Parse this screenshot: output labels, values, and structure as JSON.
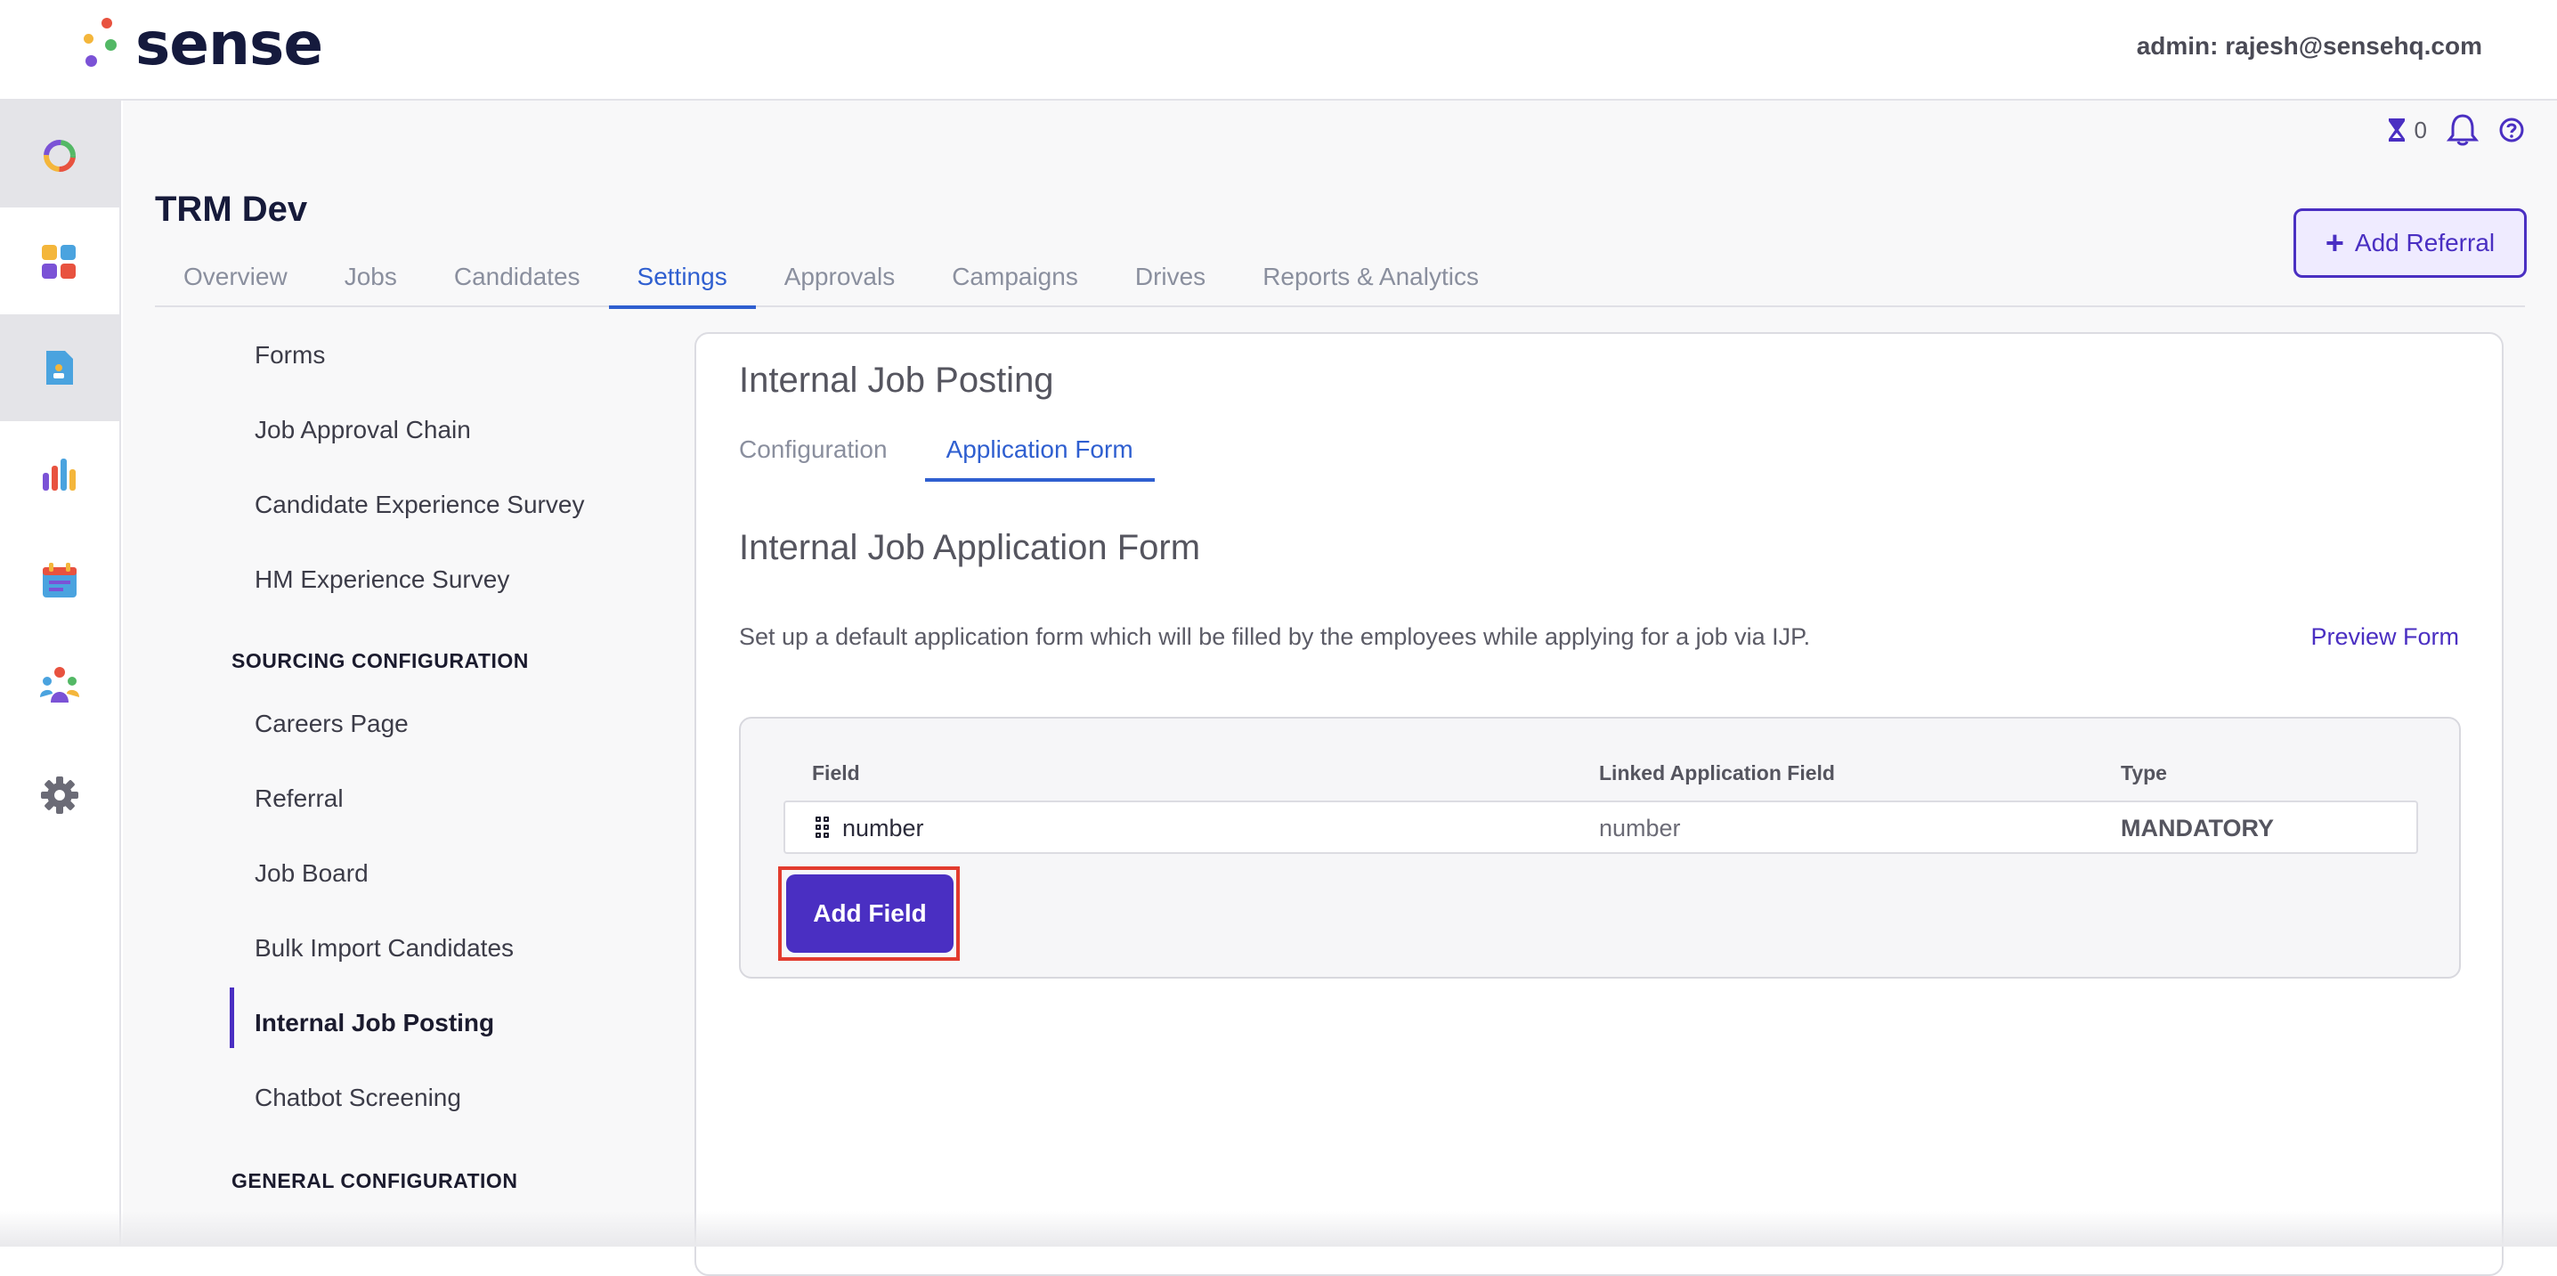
{
  "app": {
    "logo_text": "sense",
    "admin_label": "admin: rajesh@sensehq.com"
  },
  "rail": {
    "items": [
      {
        "name": "dashboard-ring-icon"
      },
      {
        "name": "apps-grid-icon"
      },
      {
        "name": "document-person-icon",
        "active": true
      },
      {
        "name": "bar-chart-icon"
      },
      {
        "name": "calendar-icon"
      },
      {
        "name": "people-group-icon"
      },
      {
        "name": "gear-icon"
      }
    ]
  },
  "utility": {
    "timer_count": "0"
  },
  "project": {
    "title": "TRM Dev"
  },
  "tabs": [
    {
      "label": "Overview"
    },
    {
      "label": "Jobs"
    },
    {
      "label": "Candidates"
    },
    {
      "label": "Settings",
      "active": true
    },
    {
      "label": "Approvals"
    },
    {
      "label": "Campaigns"
    },
    {
      "label": "Drives"
    },
    {
      "label": "Reports & Analytics"
    }
  ],
  "add_referral_label": "Add Referral",
  "subnav": {
    "items_top": [
      "Forms",
      "Job Approval Chain",
      "Candidate Experience Survey",
      "HM Experience Survey"
    ],
    "sourcing_heading": "SOURCING CONFIGURATION",
    "sourcing_items": [
      "Careers Page",
      "Referral",
      "Job Board",
      "Bulk Import Candidates",
      "Internal Job Posting",
      "Chatbot Screening"
    ],
    "active_item": "Internal Job Posting",
    "general_heading": "GENERAL CONFIGURATION"
  },
  "panel": {
    "title": "Internal Job Posting",
    "tabs": [
      {
        "label": "Configuration"
      },
      {
        "label": "Application Form",
        "active": true
      }
    ],
    "form_title": "Internal Job Application Form",
    "description": "Set up a default application form which will be filled by the employees while applying for a job via IJP.",
    "preview_label": "Preview Form",
    "table": {
      "headers": [
        "Field",
        "Linked Application Field",
        "Type"
      ],
      "rows": [
        {
          "field": "number",
          "linked": "number",
          "type": "MANDATORY"
        }
      ]
    },
    "add_field_label": "Add Field"
  },
  "colors": {
    "accent": "#4a2fc2",
    "tab_active": "#2f5fd0",
    "highlight": "#e23b2e"
  }
}
